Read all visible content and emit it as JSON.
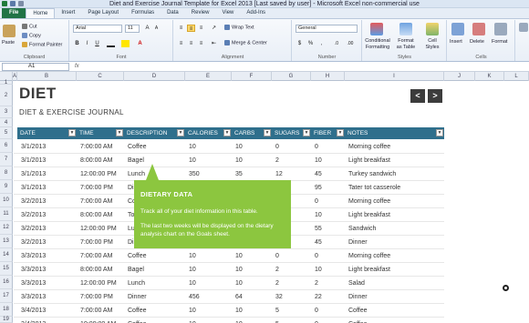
{
  "window": {
    "title": "Diet and Exercise Journal Template for Excel 2013 [Last saved by user] - Microsoft Excel non-commercial use"
  },
  "tabs": [
    "File",
    "Home",
    "Insert",
    "Page Layout",
    "Formulas",
    "Data",
    "Review",
    "View",
    "Add-Ins"
  ],
  "active_tab": "Home",
  "ribbon": {
    "clipboard": {
      "paste": "Paste",
      "cut": "Cut",
      "copy": "Copy",
      "format_painter": "Format Painter",
      "label": "Clipboard"
    },
    "font": {
      "name": "Arial",
      "size": "11",
      "bold": "B",
      "italic": "I",
      "underline": "U",
      "grow": "A",
      "shrink": "A",
      "color": "A",
      "label": "Font"
    },
    "alignment": {
      "wrap_text": "Wrap Text",
      "merge_center": "Merge & Center",
      "label": "Alignment"
    },
    "number": {
      "format": "General",
      "currency": "$",
      "percent": "%",
      "comma": ",",
      "inc_dec": ".0",
      "dec_dec": ".00",
      "label": "Number"
    },
    "styles": {
      "conditional": "Conditional",
      "conditional2": "Formatting",
      "format_as": "Format",
      "format_as2": "as Table",
      "cell_styles": "Cell",
      "cell_styles2": "Styles",
      "label": "Styles"
    },
    "cells": {
      "insert": "Insert",
      "delete": "Delete",
      "format": "Format",
      "label": "Cells"
    }
  },
  "formula_bar": {
    "name_box": "A1",
    "fx": "fx",
    "content": ""
  },
  "columns": [
    "A",
    "B",
    "C",
    "D",
    "E",
    "F",
    "G",
    "H",
    "I",
    "J",
    "K",
    "L"
  ],
  "rows": [
    "1",
    "2",
    "3",
    "4",
    "5",
    "6",
    "7",
    "8",
    "9",
    "10",
    "11",
    "12",
    "13",
    "14",
    "15",
    "16",
    "17",
    "18",
    "19"
  ],
  "sheet": {
    "title": "DIET",
    "subtitle": "DIET & EXERCISE JOURNAL",
    "prev": "<",
    "next": ">"
  },
  "table": {
    "headers": [
      "DATE",
      "TIME",
      "DESCRIPTION",
      "CALORIES",
      "CARBS",
      "SUGARS",
      "FIBER",
      "NOTES"
    ],
    "rows": [
      [
        "3/1/2013",
        "7:00:00 AM",
        "Coffee",
        "10",
        "10",
        "0",
        "0",
        "Morning coffee"
      ],
      [
        "3/1/2013",
        "8:00:00 AM",
        "Bagel",
        "10",
        "10",
        "2",
        "10",
        "Light breakfast"
      ],
      [
        "3/1/2013",
        "12:00:00 PM",
        "Lunch",
        "350",
        "35",
        "12",
        "45",
        "Turkey sandwich"
      ],
      [
        "3/1/2013",
        "7:00:00 PM",
        "Di",
        "",
        "",
        "",
        "95",
        "Tater tot casserole"
      ],
      [
        "3/2/2013",
        "7:00:00 AM",
        "Co",
        "",
        "",
        "",
        "0",
        "Morning coffee"
      ],
      [
        "3/2/2013",
        "8:00:00 AM",
        "To",
        "",
        "",
        "",
        "10",
        "Light breakfast"
      ],
      [
        "3/2/2013",
        "12:00:00 PM",
        "Lu",
        "",
        "",
        "",
        "55",
        "Sandwich"
      ],
      [
        "3/2/2013",
        "7:00:00 PM",
        "Di",
        "",
        "",
        "",
        "45",
        "Dinner"
      ],
      [
        "3/3/2013",
        "7:00:00 AM",
        "Coffee",
        "10",
        "10",
        "0",
        "0",
        "Morning coffee"
      ],
      [
        "3/3/2013",
        "8:00:00 AM",
        "Bagel",
        "10",
        "10",
        "2",
        "10",
        "Light breakfast"
      ],
      [
        "3/3/2013",
        "12:00:00 PM",
        "Lunch",
        "10",
        "10",
        "2",
        "2",
        "Salad"
      ],
      [
        "3/3/2013",
        "7:00:00 PM",
        "Dinner",
        "456",
        "64",
        "32",
        "22",
        "Dinner"
      ],
      [
        "3/4/2013",
        "7:00:00 AM",
        "Coffee",
        "10",
        "10",
        "5",
        "0",
        "Coffee"
      ],
      [
        "3/4/2013",
        "10:00:00 AM",
        "Coffee",
        "10",
        "10",
        "5",
        "0",
        "Coffee"
      ]
    ]
  },
  "tooltip": {
    "title": "DIETARY DATA",
    "line1": "Track all of your diet information in this table.",
    "line2": "The last two weeks will be displayed on the dietary analysis chart on the Goals sheet."
  },
  "colors": {
    "header": "#2f6f8c",
    "tooltip": "#8cc63f",
    "file_tab": "#217346"
  }
}
